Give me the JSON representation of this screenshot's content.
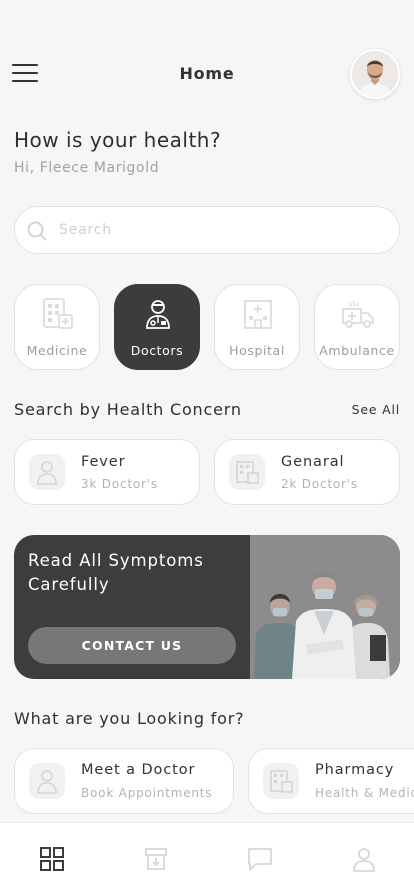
{
  "header": {
    "title": "Home",
    "menu_icon": "hamburger-menu-icon",
    "avatar": "user-avatar"
  },
  "greeting": {
    "title": "How is your health?",
    "subtitle": "Hi, Fleece Marigold"
  },
  "search": {
    "placeholder": "Search",
    "value": "",
    "icon": "search-icon"
  },
  "categories": [
    {
      "label": "Medicine",
      "icon": "medicine-icon",
      "active": false
    },
    {
      "label": "Doctors",
      "icon": "doctor-icon",
      "active": true
    },
    {
      "label": "Hospital",
      "icon": "hospital-icon",
      "active": false
    },
    {
      "label": "Ambulance",
      "icon": "ambulance-icon",
      "active": false
    }
  ],
  "health_concern": {
    "title": "Search by Health Concern",
    "see_all": "See All",
    "items": [
      {
        "title": "Fever",
        "subtitle": "3k Doctor's",
        "icon": "doctor-icon"
      },
      {
        "title": "Genaral",
        "subtitle": "2k Doctor's",
        "icon": "medicine-icon"
      }
    ]
  },
  "banner": {
    "text": "Read All Symptoms Carefully",
    "button": "CONTACT US"
  },
  "looking_for": {
    "title": "What are you Looking for?",
    "items": [
      {
        "title": "Meet a Doctor",
        "subtitle": "Book Appointments",
        "icon": "doctor-icon"
      },
      {
        "title": "Pharmacy",
        "subtitle": "Health & Medicine",
        "icon": "medicine-icon"
      }
    ]
  },
  "tabbar": {
    "tabs": [
      {
        "icon": "grid-icon",
        "active": true
      },
      {
        "icon": "box-icon",
        "active": false
      },
      {
        "icon": "chat-icon",
        "active": false
      },
      {
        "icon": "profile-icon",
        "active": false
      }
    ]
  },
  "colors": {
    "background": "#f6f6f6",
    "accent_dark": "#3c3c3c",
    "muted_text": "#a2a2a2",
    "banner_button": "#777777"
  }
}
